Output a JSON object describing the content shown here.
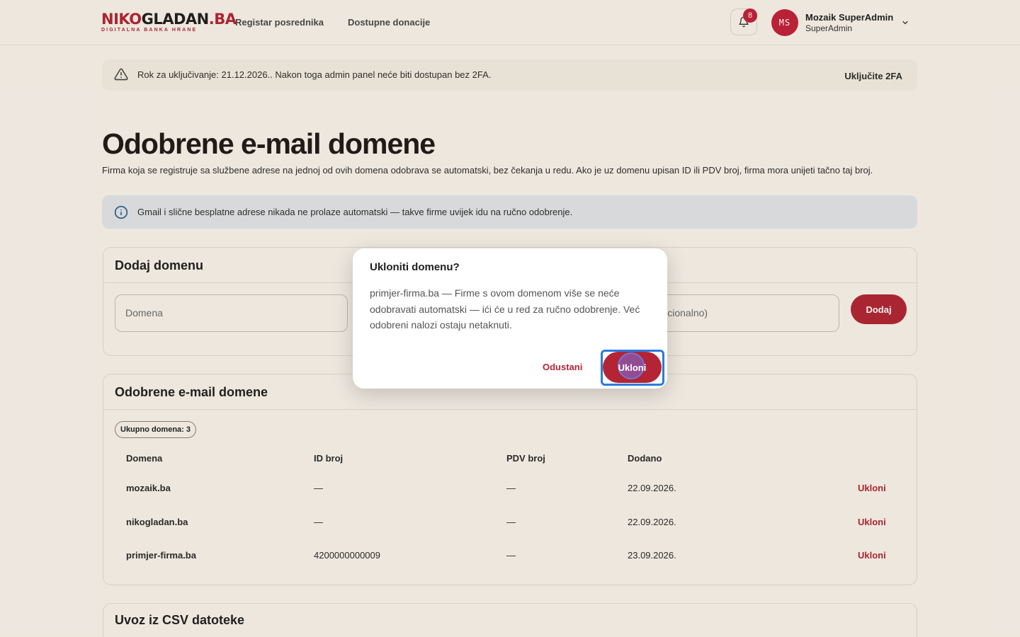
{
  "header": {
    "logo": {
      "part1": "NIKO",
      "part2": "GLADAN",
      "part3": ".BA",
      "tagline": "DIGITALNA BANKA HRANE"
    },
    "nav": [
      "Registar posrednika",
      "Dostupne donacije"
    ],
    "notifications_count": "8",
    "user": {
      "initials": "MS",
      "name": "Mozaik SuperAdmin",
      "role": "SuperAdmin"
    }
  },
  "warning": {
    "text": "Rok za uključivanje: 21.12.2026.. Nakon toga admin panel neće biti dostupan bez 2FA.",
    "action": "Uključite 2FA"
  },
  "page": {
    "title": "Odobrene e-mail domene",
    "subtitle": "Firma koja se registruje sa službene adrese na jednoj od ovih domena odobrava se automatski, bez čekanja u redu. Ako je uz domenu upisan ID ili PDV broj, firma mora unijeti tačno taj broj."
  },
  "info": {
    "text": "Gmail i slične besplatne adrese nikada ne prolaze automatski — takve firme uvijek idu na ručno odobrenje."
  },
  "add_card": {
    "title": "Dodaj domenu",
    "domain_placeholder": "Domena",
    "optional_placeholder": "(opcionalno)",
    "add_label": "Dodaj"
  },
  "list_card": {
    "title": "Odobrene e-mail domene",
    "count_chip": "Ukupno domena: 3",
    "columns": [
      "Domena",
      "ID broj",
      "PDV broj",
      "Dodano"
    ],
    "rows": [
      {
        "domain": "mozaik.ba",
        "id": "—",
        "pdv": "—",
        "added": "22.09.2026.",
        "action": "Ukloni"
      },
      {
        "domain": "nikogladan.ba",
        "id": "—",
        "pdv": "—",
        "added": "22.09.2026.",
        "action": "Ukloni"
      },
      {
        "domain": "primjer-firma.ba",
        "id": "4200000000009",
        "pdv": "—",
        "added": "23.09.2026.",
        "action": "Ukloni"
      }
    ]
  },
  "csv_card": {
    "title": "Uvoz iz CSV datoteke"
  },
  "dialog": {
    "title": "Ukloniti domenu?",
    "body": "primjer-firma.ba — Firme s ovom domenom više se neće odobravati automatski — ići će u red za ručno odobrenje. Već odobreni nalozi ostaju netaknuti.",
    "cancel": "Odustani",
    "confirm": "Ukloni"
  },
  "colors": {
    "brand": "#b32535",
    "background": "#fbf6ee",
    "info_bg": "#e3e7ea",
    "focus": "#2a7ae0"
  },
  "icons": {
    "warning": "warning-triangle-icon",
    "info": "info-circle-icon",
    "bell": "bell-icon",
    "chevron": "chevron-down-icon"
  }
}
